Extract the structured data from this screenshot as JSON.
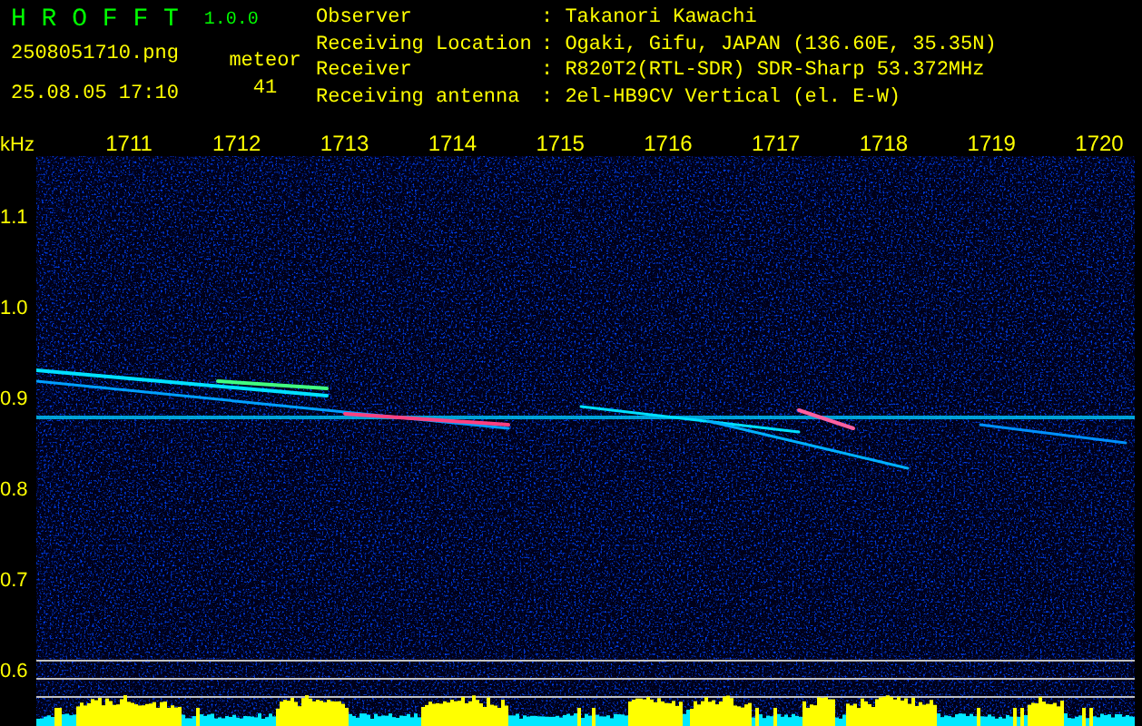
{
  "header": {
    "app_title": "H R O F F T",
    "version": "1.0.0",
    "filename": "2508051710.png",
    "datetime": "25.08.05 17:10",
    "meteor_label": "meteor",
    "meteor_count": "41"
  },
  "info": [
    {
      "label": "Observer",
      "value": ": Takanori Kawachi"
    },
    {
      "label": "Receiving Location",
      "value": ": Ogaki, Gifu, JAPAN (136.60E, 35.35N)"
    },
    {
      "label": "Receiver",
      "value": ": R820T2(RTL-SDR) SDR-Sharp 53.372MHz"
    },
    {
      "label": "Receiving antenna",
      "value": ": 2el-HB9CV Vertical (el. E-W)"
    }
  ],
  "plot": {
    "y_unit": "kHz",
    "x_labels": [
      "1711",
      "1712",
      "1713",
      "1714",
      "1715",
      "1716",
      "1717",
      "1718",
      "1719",
      "1720"
    ],
    "y_labels": [
      "1.1",
      "1.0",
      "0.9",
      "0.8",
      "0.7",
      "0.6"
    ]
  }
}
